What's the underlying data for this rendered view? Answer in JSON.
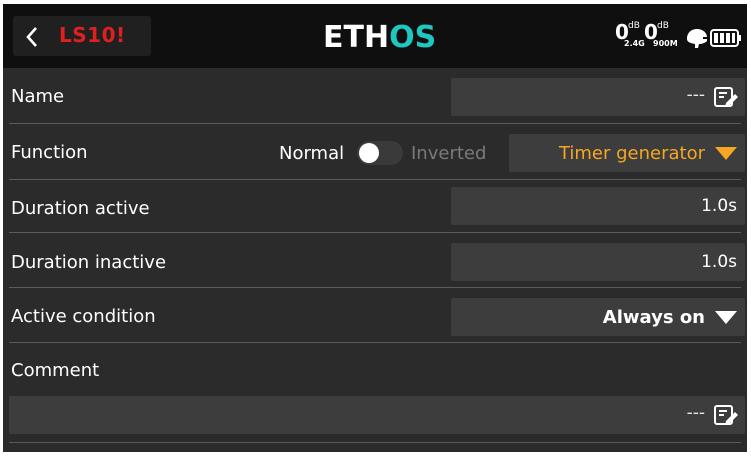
{
  "header": {
    "back_icon": "chevron-left-icon",
    "model_name": "LS10",
    "model_name_suffix": "!",
    "logo_part1": "ETH",
    "logo_part2": "OS",
    "rssi": [
      {
        "value": "0",
        "unit": "dB",
        "band": "2.4G"
      },
      {
        "value": "0",
        "unit": "dB",
        "band": "900M"
      }
    ],
    "status_icons": [
      "speaker-icon",
      "battery-icon"
    ],
    "colors": {
      "model_name": "#e02020",
      "logo_white": "#ffffff",
      "logo_accent": "#1ec7c0"
    }
  },
  "rows": {
    "name": {
      "label": "Name",
      "value": "---",
      "icon": "edit-icon"
    },
    "function": {
      "label": "Function",
      "toggle_on_label": "Normal",
      "toggle_off_label": "Inverted",
      "toggle_state": "Normal",
      "dropdown_value": "Timer generator",
      "dropdown_color": "#f5a623",
      "dropdown_icon": "chevron-down-icon"
    },
    "duration_active": {
      "label": "Duration active",
      "value": "1.0s"
    },
    "duration_inactive": {
      "label": "Duration inactive",
      "value": "1.0s"
    },
    "active_condition": {
      "label": "Active condition",
      "value": "Always on",
      "icon": "chevron-down-icon"
    },
    "comment": {
      "label": "Comment",
      "value": "---",
      "icon": "edit-icon"
    }
  }
}
